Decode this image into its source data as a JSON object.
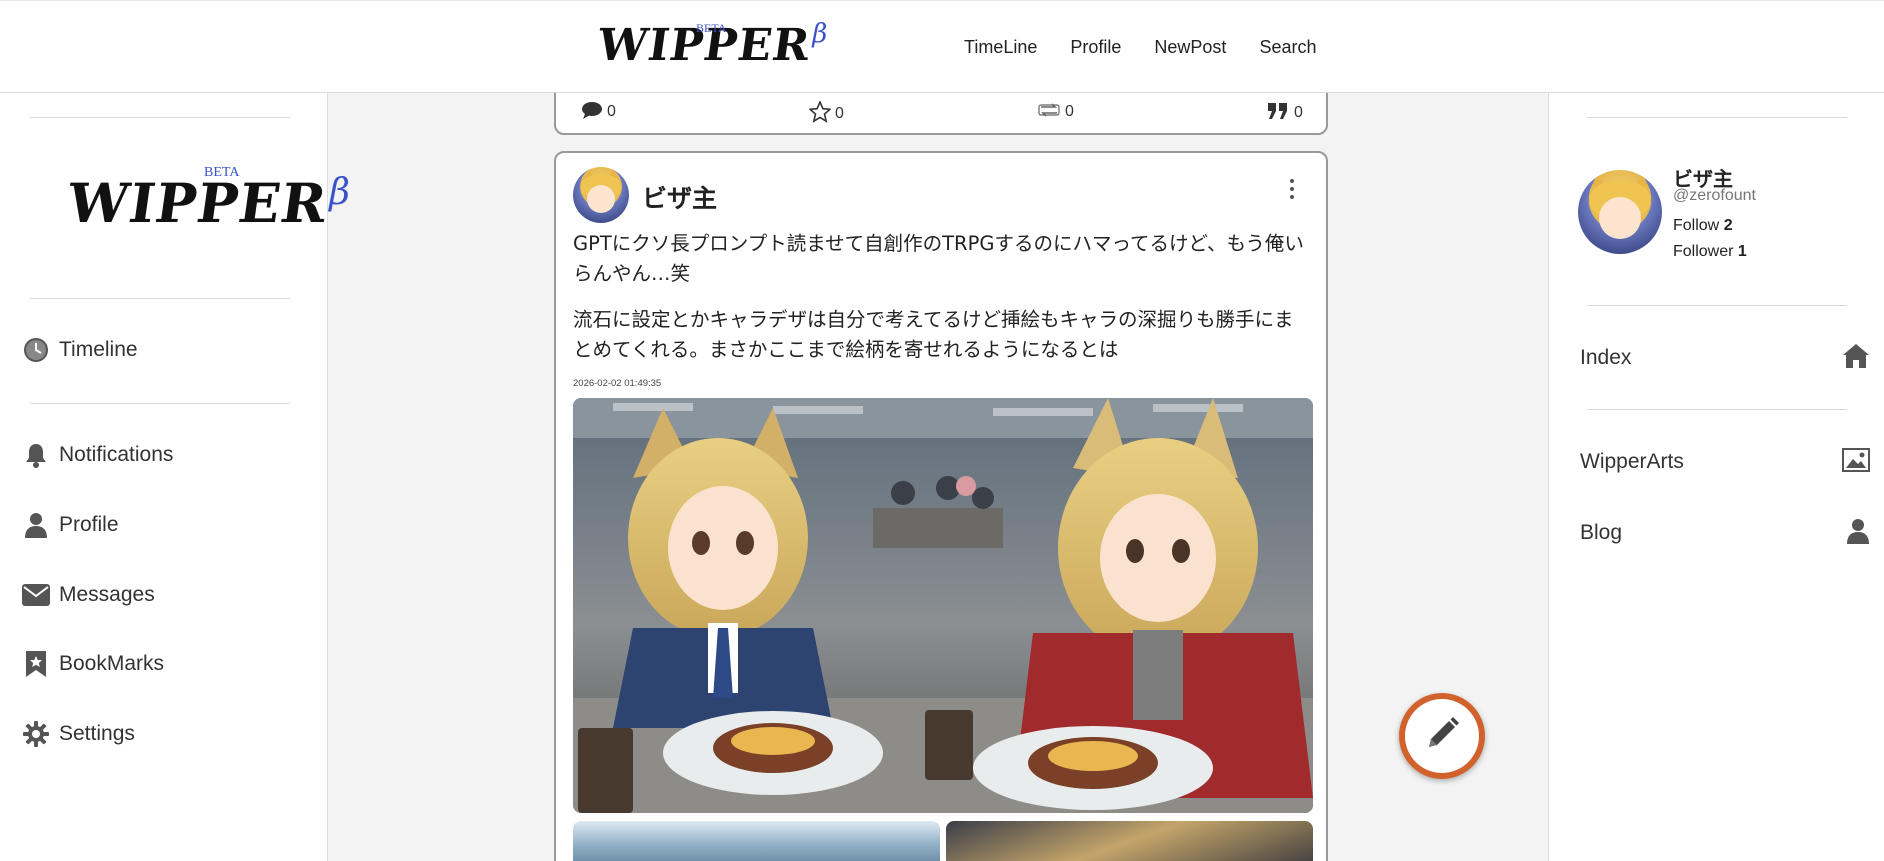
{
  "brand": {
    "word": "WIPPER",
    "beta": "BETA",
    "greek": "β"
  },
  "topnav": {
    "items": [
      "TimeLine",
      "Profile",
      "NewPost",
      "Search"
    ]
  },
  "left_nav": {
    "items": [
      {
        "label": "Timeline",
        "icon": "clock-icon"
      },
      {
        "label": "Notifications",
        "icon": "bell-icon"
      },
      {
        "label": "Profile",
        "icon": "person-icon"
      },
      {
        "label": "Messages",
        "icon": "envelope-icon"
      },
      {
        "label": "BookMarks",
        "icon": "bookmark-icon"
      },
      {
        "label": "Settings",
        "icon": "gear-icon"
      }
    ]
  },
  "prev_post": {
    "stats": {
      "comments": "0",
      "stars": "0",
      "reposts": "0",
      "quotes": "0"
    }
  },
  "post": {
    "author": "ビザ主",
    "body_1": "GPTにクソ長プロンプト読ませて自創作のTRPGするのにハマってるけど、もう俺いらんやん…笑",
    "body_2": "流石に設定とかキャラデザは自分で考えてるけど挿絵もキャラの深掘りも勝手にまとめてくれる。まさかここまで絵柄を寄せれるようになるとは",
    "date": "2026-02-02 01:49:35"
  },
  "profile": {
    "name": "ビザ主",
    "handle": "@zerofount",
    "follow_label": "Follow",
    "follow_count": "2",
    "follower_label": "Follower",
    "follower_count": "1"
  },
  "right_nav": {
    "items": [
      {
        "label": "Index",
        "icon": "home-icon"
      },
      {
        "label": "WipperArts",
        "icon": "image-icon"
      },
      {
        "label": "Blog",
        "icon": "person-icon"
      }
    ]
  },
  "colors": {
    "fab": "#d2622d",
    "beta": "#3a52c8"
  }
}
